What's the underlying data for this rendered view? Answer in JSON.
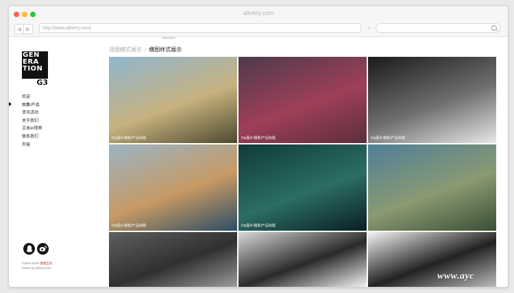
{
  "window": {
    "title": "allvery.com",
    "url": "http://www.allvery.com/"
  },
  "brand": {
    "logo_lines": [
      "GEN",
      "ERA",
      "TION",
      "G3"
    ]
  },
  "sidebar": {
    "items": [
      {
        "label": "欢迎"
      },
      {
        "label": "图集/产品"
      },
      {
        "label": "资讯活动"
      },
      {
        "label": "关于我们"
      },
      {
        "label": "文本or视频"
      },
      {
        "label": "联系我们"
      },
      {
        "label": "外链"
      }
    ],
    "active_index": 1
  },
  "social": {
    "qq_icon": "qq-icon",
    "weibo_icon": "weibo-icon"
  },
  "footer": {
    "copyright": "©2014-2016",
    "copyright_link": "傲维互动",
    "powered": "Power by allvery.com"
  },
  "view_tabs": {
    "inactive": "竖图模式展示",
    "separator": "/",
    "active": "横图样式展示"
  },
  "gallery": {
    "tiles": [
      {
        "caption": "Diy图片/摄影/产品标题",
        "colors": [
          "#8fb6cf",
          "#c7b27f",
          "#4d4a2e"
        ]
      },
      {
        "caption": "Diy图片/摄影/产品标题",
        "colors": [
          "#4f3a4c",
          "#9e3f58",
          "#5a2f3c"
        ]
      },
      {
        "caption": "Diy图片/摄影/产品标题",
        "colors": [
          "#1a1a1a",
          "#6f6f6f",
          "#e8e8e8"
        ]
      },
      {
        "caption": "Diy图片/摄影/产品标题",
        "colors": [
          "#9ab4c3",
          "#c79a65",
          "#2c4d63"
        ]
      },
      {
        "caption": "Diy图片/摄影/产品标题",
        "colors": [
          "#0f3b3a",
          "#2c6d66",
          "#0a1f22"
        ]
      },
      {
        "caption": "",
        "colors": [
          "#4f7f97",
          "#8a9a72",
          "#3a4f36"
        ]
      },
      {
        "caption": "",
        "colors": [
          "#5f5f5f",
          "#303030",
          "#9a9a9a"
        ]
      },
      {
        "caption": "",
        "colors": [
          "#d8d8d8",
          "#2a2a2a",
          "#f2f2f2"
        ]
      },
      {
        "caption": "",
        "colors": [
          "#f4f4f4",
          "#222222",
          "#bbbbbb"
        ]
      }
    ]
  },
  "watermark": "www.ayc"
}
